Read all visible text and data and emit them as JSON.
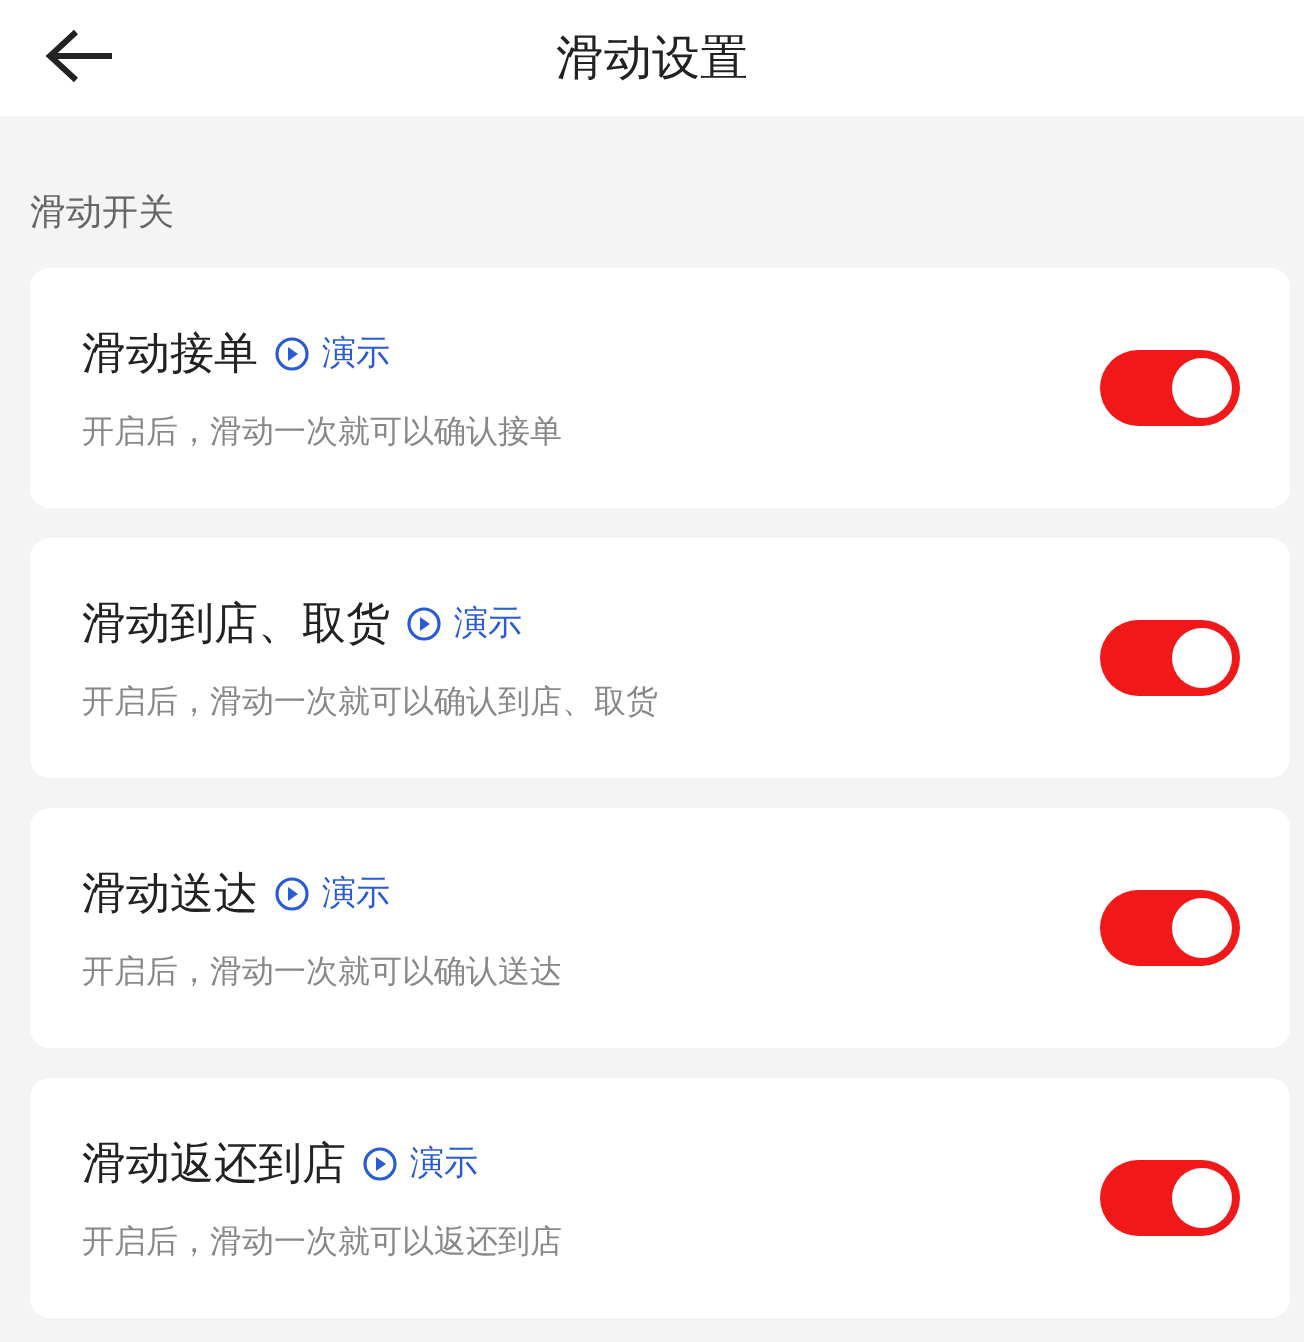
{
  "header": {
    "title": "滑动设置"
  },
  "section": {
    "label": "滑动开关"
  },
  "settings": [
    {
      "title": "滑动接单",
      "demo": "演示",
      "description": "开启后，滑动一次就可以确认接单",
      "on": true
    },
    {
      "title": "滑动到店、取货",
      "demo": "演示",
      "description": "开启后，滑动一次就可以确认到店、取货",
      "on": true
    },
    {
      "title": "滑动送达",
      "demo": "演示",
      "description": "开启后，滑动一次就可以确认送达",
      "on": true
    },
    {
      "title": "滑动返还到店",
      "demo": "演示",
      "description": "开启后，滑动一次就可以返还到店",
      "on": true
    }
  ]
}
